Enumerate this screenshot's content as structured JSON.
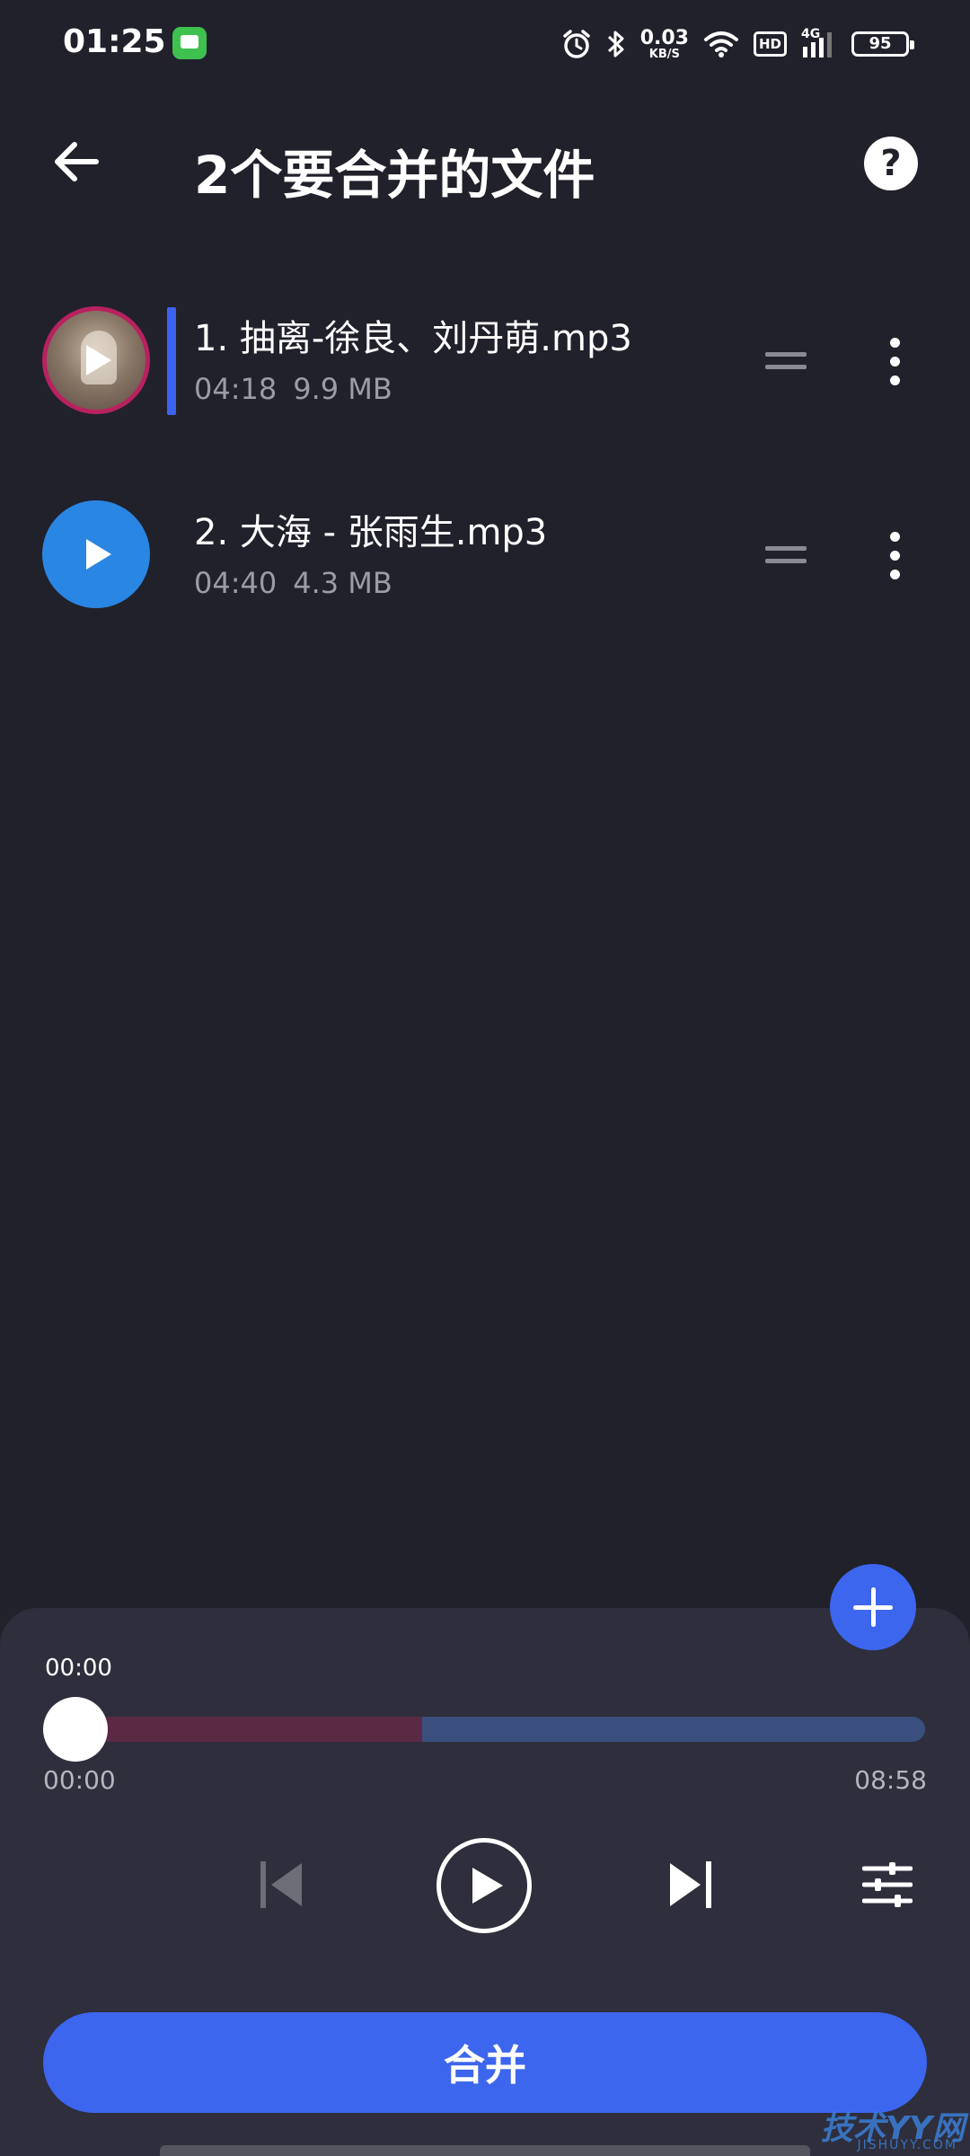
{
  "status_bar": {
    "time": "01:25",
    "net_speed_value": "0.03",
    "net_speed_unit": "KB/S",
    "hd_label": "HD",
    "signal_label": "4G",
    "battery_level": "95",
    "icons": [
      "message-icon",
      "alarm-icon",
      "bluetooth-icon",
      "wifi-icon",
      "signal-icon",
      "battery-icon"
    ]
  },
  "header": {
    "title": "2个要合并的文件",
    "help_label": "?"
  },
  "files": [
    {
      "name": "1. 抽离-徐良、刘丹萌.mp3",
      "duration": "04:18",
      "size": "9.9 MB",
      "active": true
    },
    {
      "name": "2. 大海 - 张雨生.mp3",
      "duration": "04:40",
      "size": "4.3 MB",
      "active": false
    }
  ],
  "player": {
    "current_time_label": "00:00",
    "start_time": "00:00",
    "total_time": "08:58",
    "progress": 0.0,
    "segment_split_fraction": 0.41,
    "segment_colors": [
      "#5a2944",
      "#3a4f7e"
    ]
  },
  "actions": {
    "merge_label": "合并"
  },
  "watermark": {
    "text": "技术YY网",
    "sub": "JISHUYY.COM"
  },
  "colors": {
    "background": "#21212b",
    "panel": "#2e2e3c",
    "accent": "#3d66ee",
    "active_bar": "#3b63f0",
    "play_blue": "#2a86e3"
  }
}
